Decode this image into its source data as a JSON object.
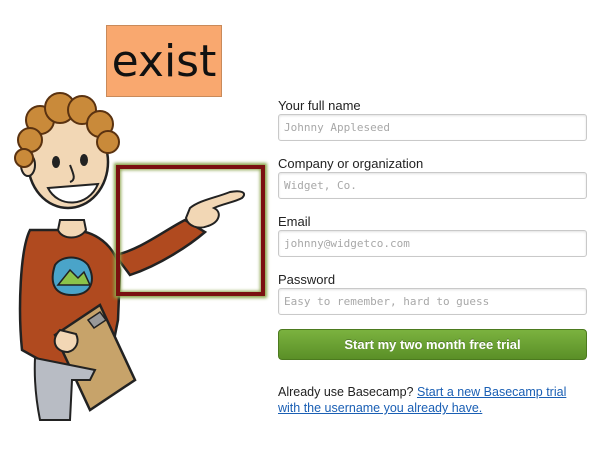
{
  "annotation": {
    "label": "exist"
  },
  "form": {
    "name_label": "Your full name",
    "name_placeholder": "Johnny Appleseed",
    "company_label": "Company or organization",
    "company_placeholder": "Widget, Co.",
    "email_label": "Email",
    "email_placeholder": "johnny@widgetco.com",
    "password_label": "Password",
    "password_placeholder": "Easy to remember, hard to guess",
    "submit_label": "Start my two month free trial"
  },
  "footer": {
    "prompt": "Already use Basecamp?",
    "link": "Start a new Basecamp trial with the username you already have."
  },
  "colors": {
    "button": "#6aa334",
    "link": "#1a5fb4",
    "annotation_bg": "#f9a86f",
    "highlight_border": "#7a1010"
  }
}
